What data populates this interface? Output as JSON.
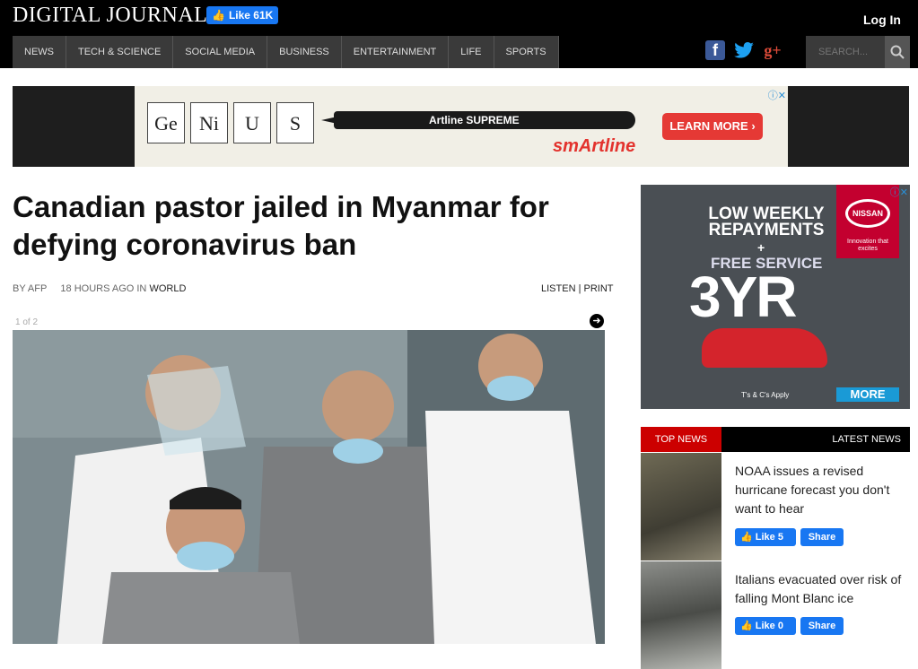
{
  "header": {
    "logo": "DIGITAL JOURNAL",
    "fb_like": "Like 61K",
    "login": "Log In",
    "nav": [
      "NEWS",
      "TECH & SCIENCE",
      "SOCIAL MEDIA",
      "BUSINESS",
      "ENTERTAINMENT",
      "LIFE",
      "SPORTS"
    ],
    "search_placeholder": "SEARCH...",
    "social": {
      "facebook": "f",
      "twitter": "t",
      "google_plus": "g+"
    }
  },
  "ad_top": {
    "elements": [
      {
        "symbol": "Ge"
      },
      {
        "symbol": "Ni"
      },
      {
        "symbol": "U"
      },
      {
        "symbol": "S"
      }
    ],
    "pen_label": "Artline SUPREME",
    "brand": "smArtline",
    "cta": "LEARN MORE ›"
  },
  "article": {
    "headline": "Canadian pastor jailed in Myanmar for defying coronavirus ban",
    "by": "BY AFP",
    "time": "18 HOURS AGO IN",
    "category": "WORLD",
    "listen": "LISTEN",
    "print": "PRINT",
    "slide_count": "1 of 2"
  },
  "ad_right": {
    "line1": "LOW WEEKLY REPAYMENTS",
    "plus": "+",
    "line2": "FREE SERVICE",
    "big": "3YR",
    "brand": "NISSAN",
    "tagline": "Innovation that excites",
    "tc": "T's & C's Apply",
    "cta": "MORE"
  },
  "news_tabs": {
    "top": "TOP NEWS",
    "latest": "LATEST NEWS"
  },
  "news": [
    {
      "title": "NOAA issues a revised hurricane forecast you don't want to hear",
      "like": "Like 5",
      "share": "Share"
    },
    {
      "title": "Italians evacuated over risk of falling Mont Blanc ice",
      "like": "Like 0",
      "share": "Share"
    }
  ],
  "colors": {
    "accent": "#cc0000",
    "facebook": "#1877f2",
    "twitter": "#1da1f2",
    "google": "#dd4b39"
  }
}
